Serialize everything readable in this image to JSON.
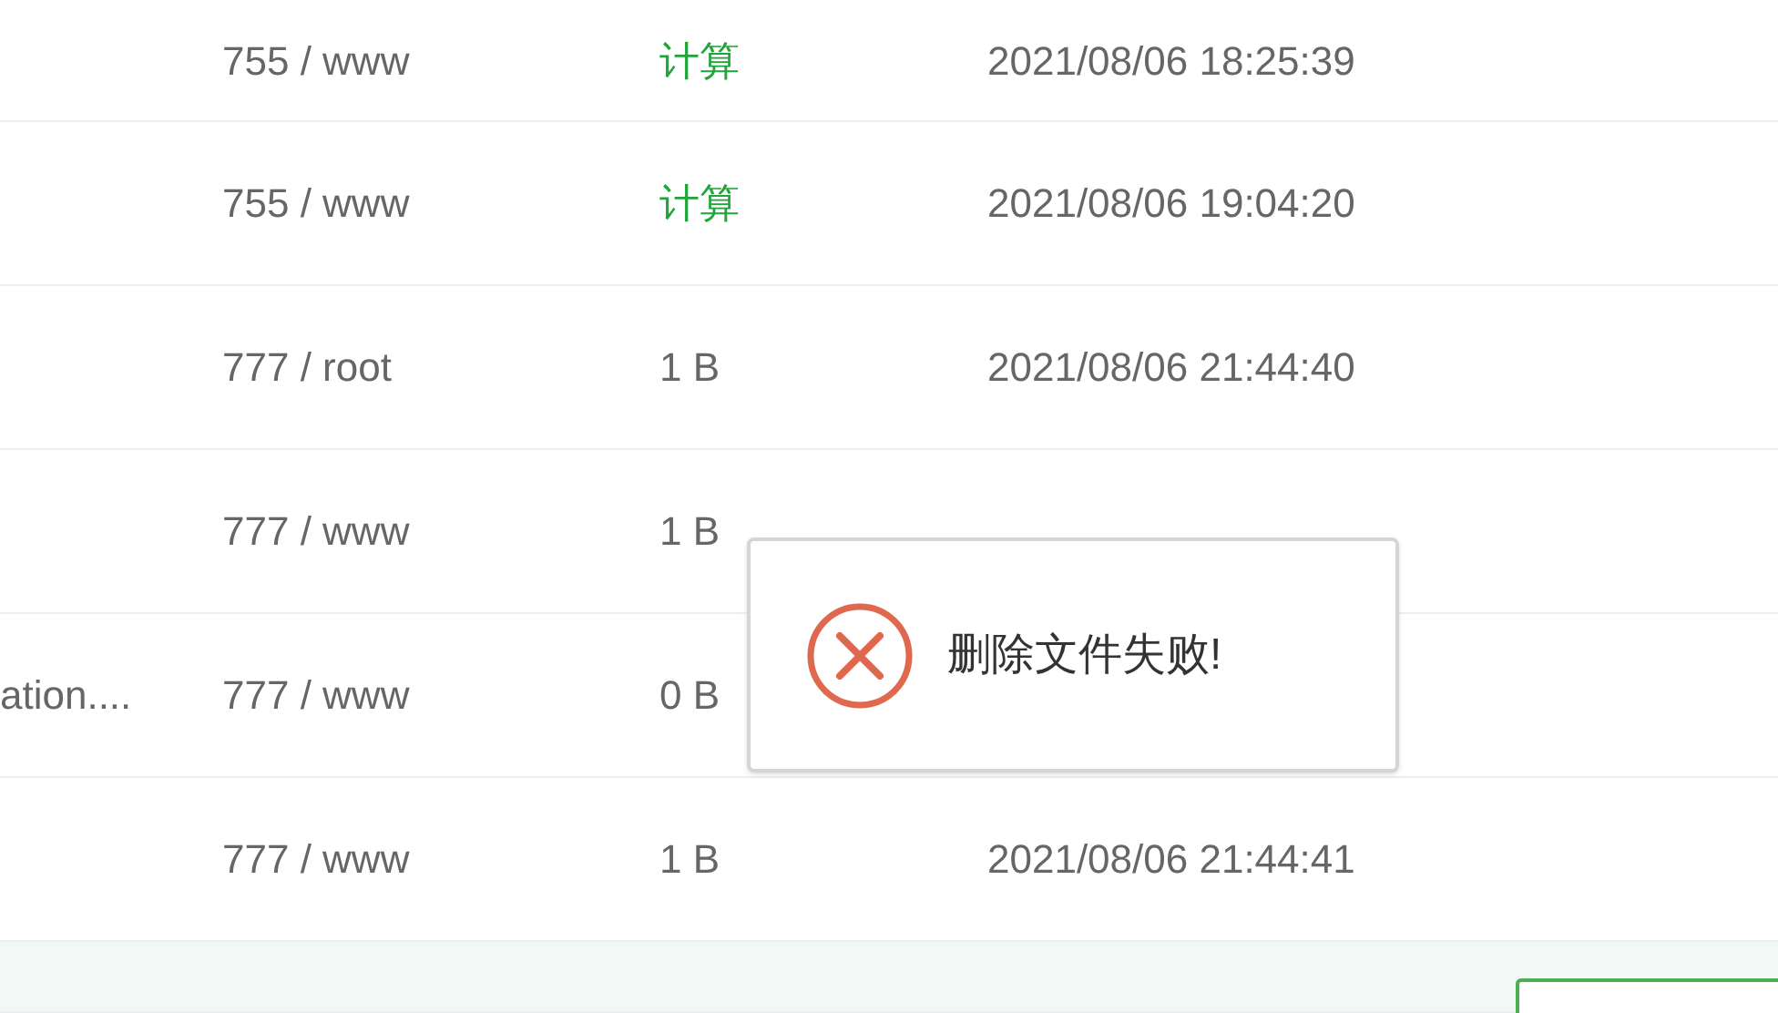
{
  "rows": [
    {
      "permission": "755 / www",
      "size": {
        "kind": "link",
        "text": "计算"
      },
      "modified": "2021/08/06 18:25:39",
      "hovered": false
    },
    {
      "permission": "755 / www",
      "size": {
        "kind": "link",
        "text": "计算"
      },
      "modified": "2021/08/06 19:04:20",
      "hovered": false
    },
    {
      "permission": "777 / root",
      "size": {
        "kind": "text",
        "text": "1 B"
      },
      "modified": "2021/08/06 21:44:40",
      "hovered": false
    },
    {
      "permission": "777 / www",
      "size": {
        "kind": "text",
        "text": "1 B"
      },
      "hovered": false
    },
    {
      "name": "ation....",
      "permission": "777 / www",
      "size": {
        "kind": "text",
        "text": "0 B"
      },
      "hovered": false
    },
    {
      "permission": "777 / www",
      "size": {
        "kind": "text",
        "text": "1 B"
      },
      "modified": "2021/08/06 21:44:41",
      "hovered": false
    },
    {
      "hovered": true
    }
  ],
  "toast": {
    "kind": "error",
    "message": "删除文件失败!"
  }
}
